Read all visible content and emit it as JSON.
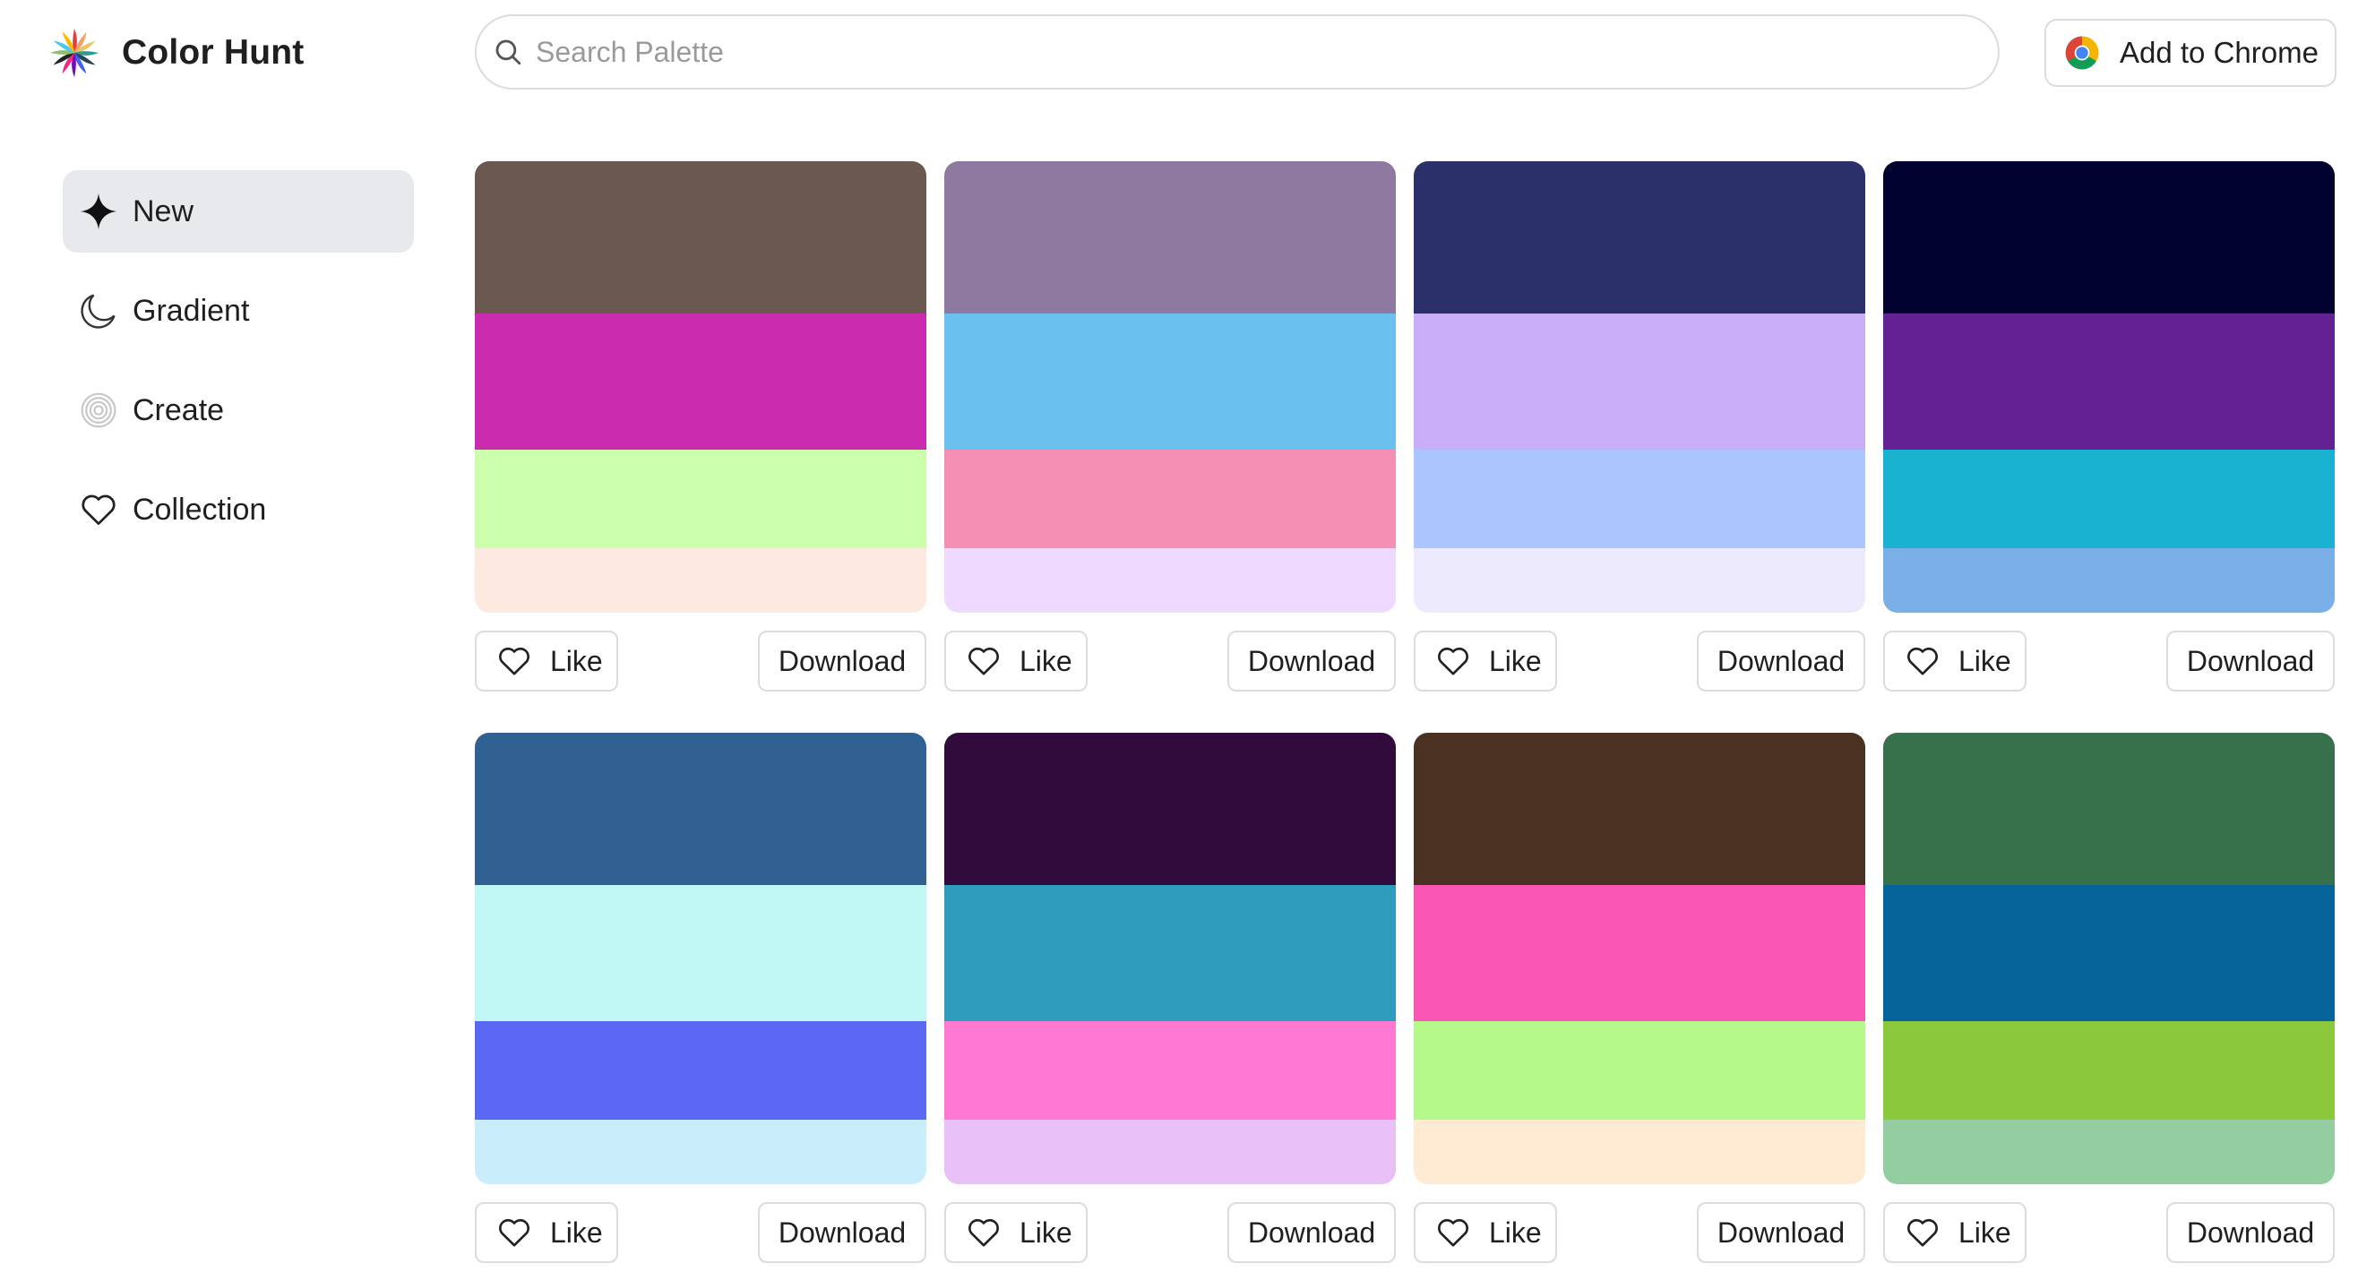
{
  "header": {
    "app_name": "Color Hunt",
    "search_placeholder": "Search Palette",
    "chrome_button_label": "Add to Chrome"
  },
  "sidebar": {
    "items": [
      {
        "label": "New",
        "icon": "sparkle-icon",
        "active": true
      },
      {
        "label": "Gradient",
        "icon": "moon-icon",
        "active": false
      },
      {
        "label": "Create",
        "icon": "spiral-icon",
        "active": false
      },
      {
        "label": "Collection",
        "icon": "heart-icon",
        "active": false
      }
    ]
  },
  "palette_actions": {
    "like_label": "Like",
    "download_label": "Download"
  },
  "palettes": [
    {
      "colors": [
        "#6B5850",
        "#CB2BAF",
        "#CCFFAB",
        "#FEE9E1"
      ]
    },
    {
      "colors": [
        "#8E7AA0",
        "#6AC0EE",
        "#F68FB4",
        "#EDDAFE"
      ]
    },
    {
      "colors": [
        "#2B306A",
        "#C8AEF7",
        "#AAC6FC",
        "#EDEAFE"
      ]
    },
    {
      "colors": [
        "#020230",
        "#632193",
        "#1AB2D1",
        "#7AAEE6"
      ]
    },
    {
      "colors": [
        "#306192",
        "#C1F7F4",
        "#5A67F2",
        "#CAEDFC"
      ]
    },
    {
      "colors": [
        "#300B3C",
        "#2E9DBD",
        "#FF78D1",
        "#E9BFF7"
      ]
    },
    {
      "colors": [
        "#4A3121",
        "#F956B6",
        "#B3F889",
        "#FFEBD3"
      ]
    },
    {
      "colors": [
        "#37714C",
        "#07649B",
        "#8BC83C",
        "#94CEA0"
      ]
    }
  ]
}
